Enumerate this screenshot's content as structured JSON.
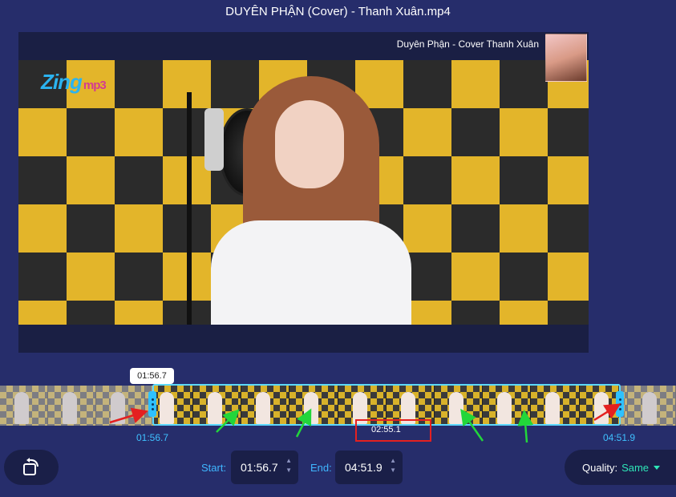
{
  "window": {
    "title": "DUYÊN PHẬN (Cover) - Thanh Xuân.mp4"
  },
  "video": {
    "caption": "Duyên Phận - Cover Thanh Xuân",
    "logo_text": "Zing",
    "logo_suffix": "mp3"
  },
  "timeline": {
    "playhead_time": "01:56.7",
    "selection_start_time": "01:56.7",
    "selection_end_time": "04:51.9",
    "selection_duration": "02:55.1",
    "frame_count": 14
  },
  "controls": {
    "start_label": "Start:",
    "start_value": "01:56.7",
    "end_label": "End:",
    "end_value": "04:51.9",
    "quality_label": "Quality:",
    "quality_value": "Same",
    "reset_icon": "rotate-icon",
    "spin_up_icon": "▲",
    "spin_down_icon": "▼"
  },
  "colors": {
    "background": "#262d6b",
    "accent": "#3fc0ff",
    "quality_accent": "#2ee6b8",
    "annotation_red": "#e42020",
    "annotation_green": "#22d63a"
  }
}
